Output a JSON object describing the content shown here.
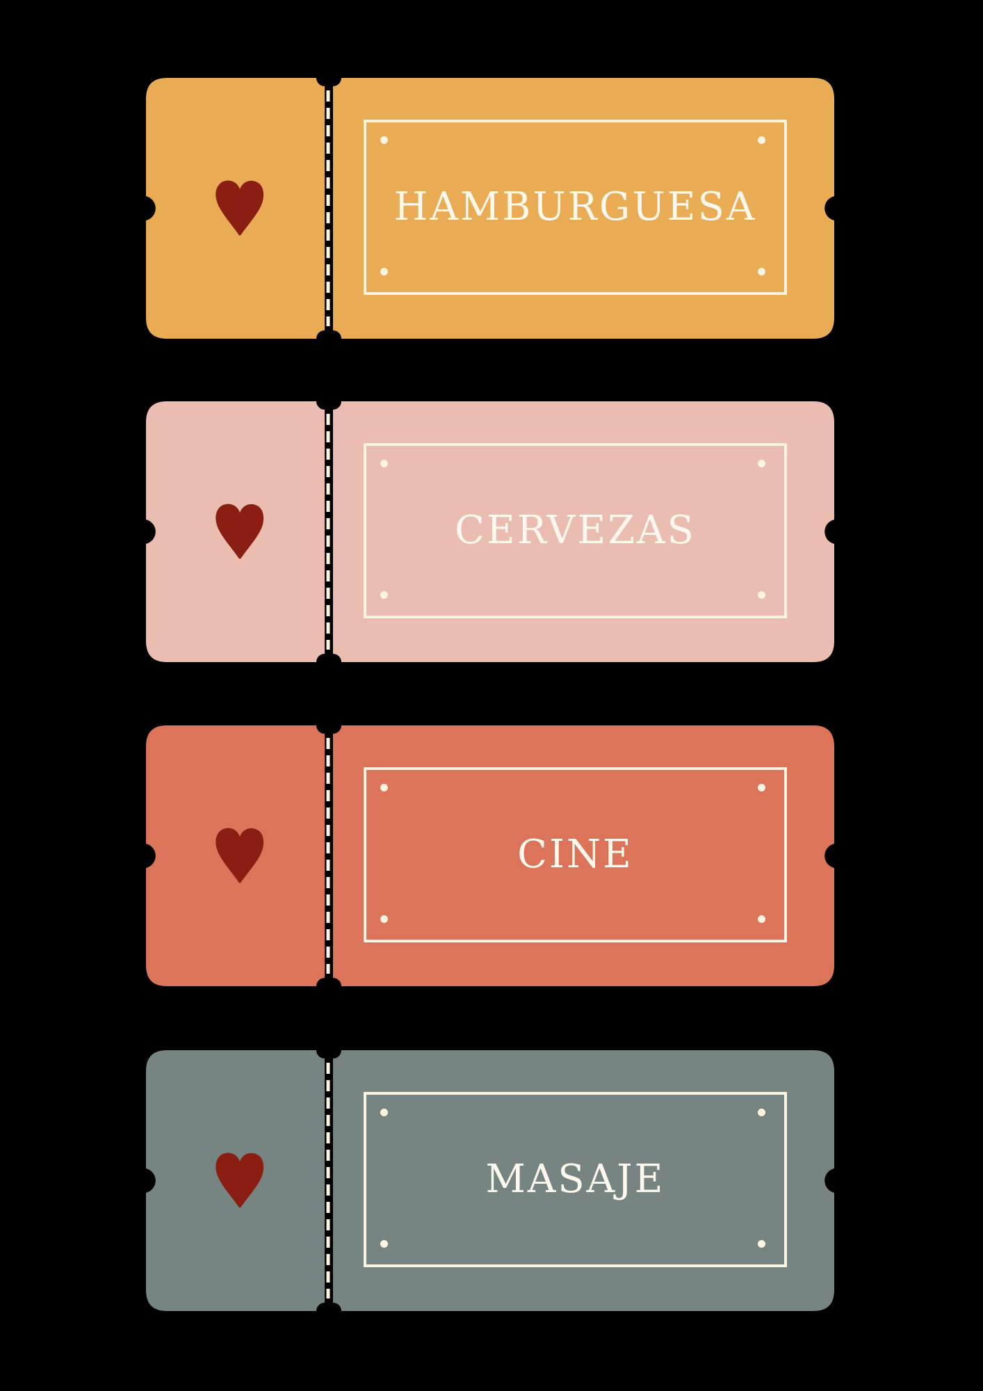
{
  "colors": {
    "background": "#000000",
    "heart": "#8b1e12",
    "line": "#fdf3e1"
  },
  "tickets": [
    {
      "label": "HAMBURGUESA",
      "color": "#e9ac55",
      "icon": "heart-icon"
    },
    {
      "label": "CERVEZAS",
      "color": "#eabdb0",
      "icon": "heart-icon"
    },
    {
      "label": "CINE",
      "color": "#dc7459",
      "icon": "heart-icon"
    },
    {
      "label": "MASAJE",
      "color": "#768582",
      "icon": "heart-icon"
    }
  ]
}
